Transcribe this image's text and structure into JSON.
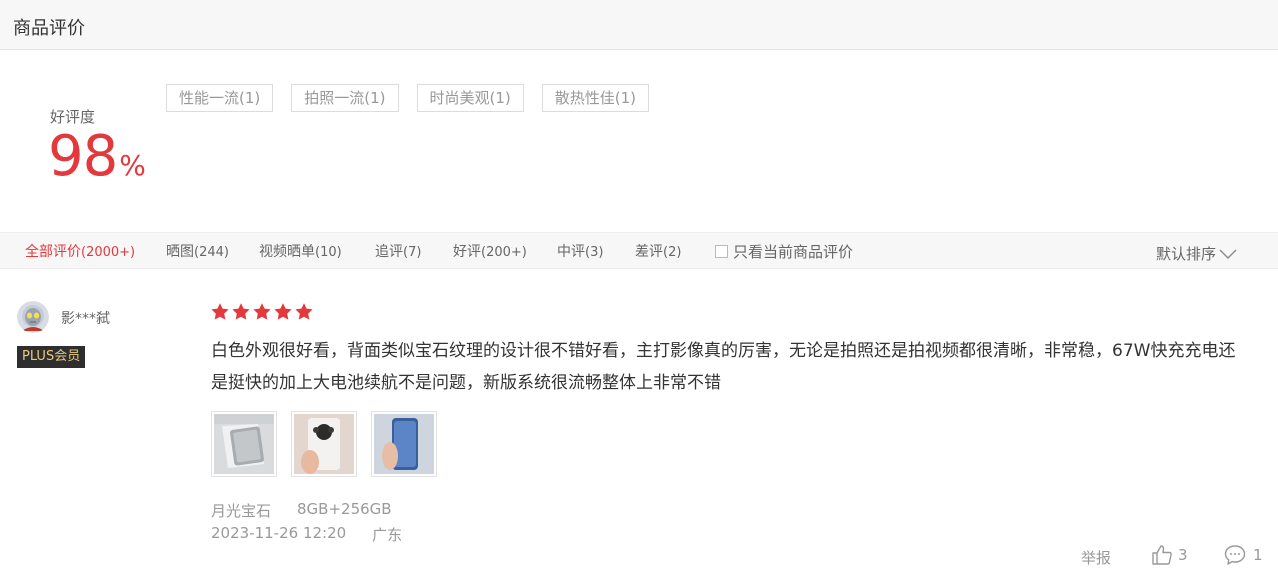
{
  "header": {
    "title": "商品评价"
  },
  "rating": {
    "label": "好评度",
    "value": "98",
    "unit": "%"
  },
  "tags": [
    {
      "label": "性能一流(1)"
    },
    {
      "label": "拍照一流(1)"
    },
    {
      "label": "时尚美观(1)"
    },
    {
      "label": "散热性佳(1)"
    }
  ],
  "filters": [
    {
      "label": "全部评价",
      "count": "(2000+)"
    },
    {
      "label": "晒图",
      "count": "(244)"
    },
    {
      "label": "视频晒单",
      "count": "(10)"
    },
    {
      "label": "追评",
      "count": "(7)"
    },
    {
      "label": "好评",
      "count": "(200+)"
    },
    {
      "label": "中评",
      "count": "(3)"
    },
    {
      "label": "差评",
      "count": "(2)"
    }
  ],
  "only_current": "只看当前商品评价",
  "sort_label": "默认排序",
  "review": {
    "username": "影***弑",
    "badge": "PLUS会员",
    "stars": 5,
    "text": "白色外观很好看，背面类似宝石纹理的设计很不错好看，主打影像真的厉害，无论是拍照还是拍视频都很清晰，非常稳，67W快充充电还是挺快的加上大电池续航不是问题，新版系统很流畅整体上非常不错",
    "thumbnails": [
      "photo-thumbnail-1",
      "photo-thumbnail-2",
      "photo-thumbnail-3"
    ],
    "color": "月光宝石",
    "spec": "8GB+256GB",
    "datetime": "2023-11-26 12:20",
    "location": "广东",
    "report_label": "举报",
    "likes": "3",
    "replies": "1"
  },
  "colors": {
    "accent": "#e4393c",
    "badge_bg": "#2e2e2e",
    "badge_text": "#e9c97c"
  }
}
